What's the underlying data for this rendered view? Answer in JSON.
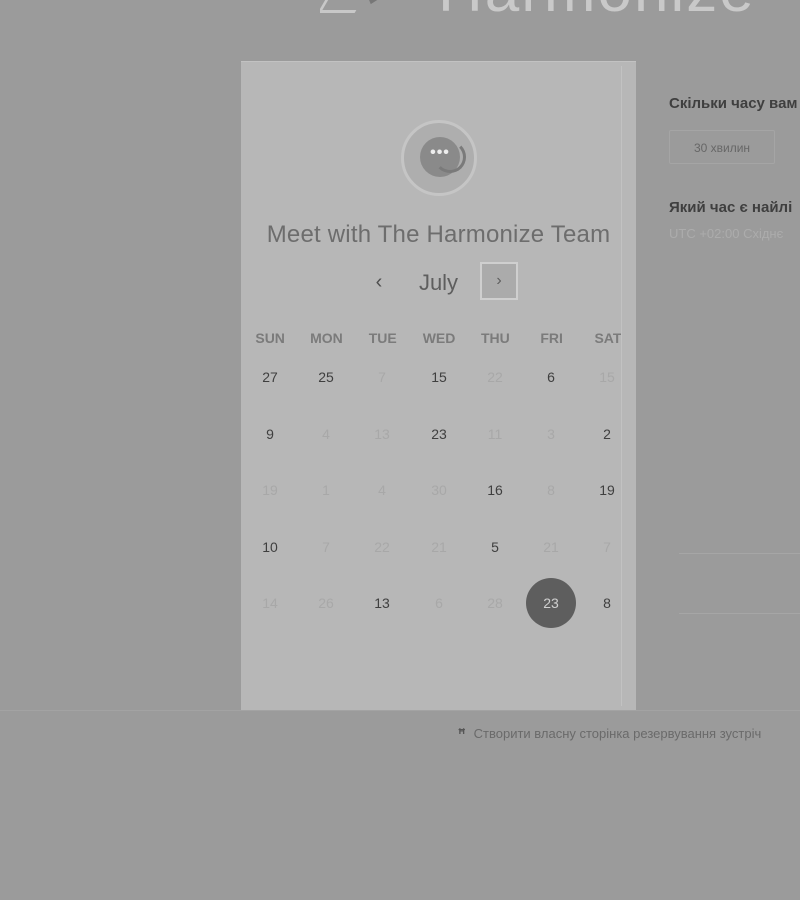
{
  "brand": {
    "logo_text": "Harmonize"
  },
  "meeting": {
    "title": "Meet with The Harmonize Team",
    "avatar_icon": "chat-bubble-icon",
    "avatar_dots": "•••"
  },
  "calendar": {
    "month": "July",
    "prev_glyph": "‹",
    "next_glyph": "›",
    "weekdays": [
      "SUN",
      "MON",
      "TUE",
      "WED",
      "THU",
      "FRI",
      "SAT"
    ],
    "weeks": [
      [
        {
          "d": "27",
          "a": true
        },
        {
          "d": "25",
          "a": true
        },
        {
          "d": "7",
          "a": false
        },
        {
          "d": "15",
          "a": true
        },
        {
          "d": "22",
          "a": false
        },
        {
          "d": "6",
          "a": true
        },
        {
          "d": "15",
          "a": false
        }
      ],
      [
        {
          "d": "9",
          "a": true
        },
        {
          "d": "4",
          "a": false
        },
        {
          "d": "13",
          "a": false
        },
        {
          "d": "23",
          "a": true
        },
        {
          "d": "11",
          "a": false
        },
        {
          "d": "3",
          "a": false
        },
        {
          "d": "2",
          "a": true
        }
      ],
      [
        {
          "d": "19",
          "a": false
        },
        {
          "d": "1",
          "a": false
        },
        {
          "d": "4",
          "a": false
        },
        {
          "d": "30",
          "a": false
        },
        {
          "d": "16",
          "a": true
        },
        {
          "d": "8",
          "a": false
        },
        {
          "d": "19",
          "a": true
        }
      ],
      [
        {
          "d": "10",
          "a": true
        },
        {
          "d": "7",
          "a": false
        },
        {
          "d": "22",
          "a": false
        },
        {
          "d": "21",
          "a": false
        },
        {
          "d": "5",
          "a": true
        },
        {
          "d": "21",
          "a": false
        },
        {
          "d": "7",
          "a": false
        }
      ],
      [
        {
          "d": "14",
          "a": false
        },
        {
          "d": "26",
          "a": false
        },
        {
          "d": "13",
          "a": true
        },
        {
          "d": "6",
          "a": false
        },
        {
          "d": "28",
          "a": false
        },
        {
          "d": "23",
          "a": true,
          "selected": true
        },
        {
          "d": "8",
          "a": true
        }
      ]
    ]
  },
  "booking": {
    "question_duration": "Скільки часу вам",
    "duration_option": "30 хвилин",
    "question_time": "Який час є найлі",
    "timezone": "UTC +02:00 Східнє"
  },
  "footer": {
    "link_text": "Створити власну сторінка резервування зустріч",
    "icon": "sprocket-icon"
  }
}
